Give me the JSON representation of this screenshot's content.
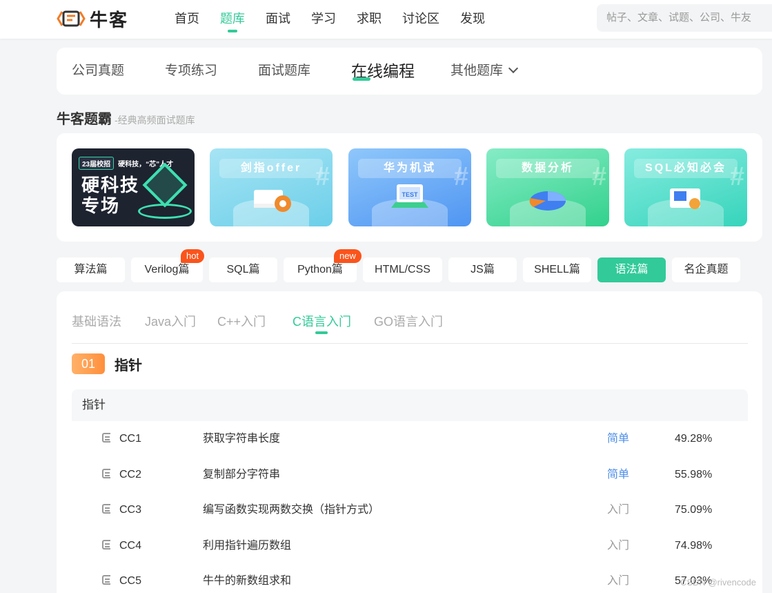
{
  "brand": {
    "name": "牛客",
    "accent": "#32ca99"
  },
  "topnav": {
    "items": [
      {
        "label": "首页",
        "active": false
      },
      {
        "label": "题库",
        "active": true
      },
      {
        "label": "面试",
        "active": false
      },
      {
        "label": "学习",
        "active": false
      },
      {
        "label": "求职",
        "active": false
      },
      {
        "label": "讨论区",
        "active": false
      },
      {
        "label": "发现",
        "active": false
      }
    ],
    "search_placeholder": "帖子、文章、试题、公司、牛友"
  },
  "category_tabs": [
    {
      "label": "公司真题"
    },
    {
      "label": "专项练习"
    },
    {
      "label": "面试题库"
    },
    {
      "label": "在线编程",
      "active": true
    },
    {
      "label": "其他题库",
      "icon": "chevron-down-icon"
    }
  ],
  "section": {
    "title": "牛客题霸",
    "subtitle": "-经典高频面试题库"
  },
  "banners": [
    {
      "tag": "23届校招",
      "headline": "硬科技，“芯”人才",
      "title": "硬科技专场"
    },
    {
      "title": "剑指offer"
    },
    {
      "title": "华为机试"
    },
    {
      "title": "数据分析"
    },
    {
      "title": "SQL必知必会"
    }
  ],
  "subtabs": [
    {
      "label": "算法篇"
    },
    {
      "label": "Verilog篇",
      "badge": "hot"
    },
    {
      "label": "SQL篇"
    },
    {
      "label": "Python篇",
      "badge": "new"
    },
    {
      "label": "HTML/CSS"
    },
    {
      "label": "JS篇"
    },
    {
      "label": "SHELL篇"
    },
    {
      "label": "语法篇",
      "active": true
    },
    {
      "label": "名企真题"
    }
  ],
  "lang_tabs": [
    {
      "label": "基础语法"
    },
    {
      "label": "Java入门"
    },
    {
      "label": "C++入门"
    },
    {
      "label": "C语言入门",
      "active": true
    },
    {
      "label": "GO语言入门"
    }
  ],
  "chapter": {
    "number": "01",
    "name": "指针"
  },
  "table": {
    "header": "指针",
    "rows": [
      {
        "code": "CC1",
        "title": "获取字符串长度",
        "difficulty": "简单",
        "rate": "49.28%"
      },
      {
        "code": "CC2",
        "title": "复制部分字符串",
        "difficulty": "简单",
        "rate": "55.98%"
      },
      {
        "code": "CC3",
        "title": "编写函数实现两数交换（指针方式）",
        "difficulty": "入门",
        "rate": "75.09%"
      },
      {
        "code": "CC4",
        "title": "利用指针遍历数组",
        "difficulty": "入门",
        "rate": "74.98%"
      },
      {
        "code": "CC5",
        "title": "牛牛的新数组求和",
        "difficulty": "入门",
        "rate": "57.03%"
      }
    ]
  },
  "watermark": "CSDN @rivencode",
  "colors": {
    "accent": "#32ca99",
    "easy": "#4d8ee8",
    "badge": "#fa541c",
    "chapter": "#ff8f3c"
  }
}
